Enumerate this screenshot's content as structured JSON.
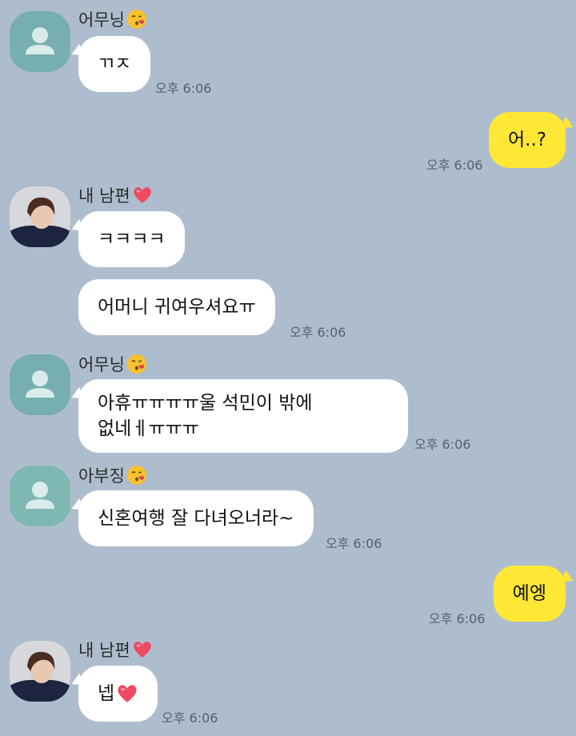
{
  "colors": {
    "background": "#aebdcd",
    "incoming_bubble": "#ffffff",
    "outgoing_bubble": "#fee835"
  },
  "messages": [
    {
      "sender": "어무닝",
      "sender_emoji": "kissing-face-icon",
      "text": "ㄲㅈ",
      "time": "오후 6:06"
    },
    {
      "outgoing": true,
      "text": "어..?",
      "time": "오후 6:06"
    },
    {
      "sender": "내 남편",
      "sender_emoji": "heart-icon",
      "texts": [
        "ㅋㅋㅋㅋ",
        "어머니 귀여우셔요ㅠ"
      ],
      "time": "오후 6:06"
    },
    {
      "sender": "어무닝",
      "sender_emoji": "kissing-face-icon",
      "text_line1": "아휴ㅠㅠㅠㅠ울 석민이 밖에",
      "text_line2": "없네ㅔㅠㅠㅠ",
      "time": "오후 6:06"
    },
    {
      "sender": "아부징",
      "sender_emoji": "kissing-face-icon",
      "text": "신혼여행 잘 다녀오너라~",
      "time": "오후 6:06"
    },
    {
      "outgoing": true,
      "text": "예엥",
      "time": "오후 6:06"
    },
    {
      "sender": "내 남편",
      "sender_emoji": "heart-icon",
      "text": "넵",
      "text_emoji": "heart-icon",
      "time": "오후 6:06"
    }
  ]
}
